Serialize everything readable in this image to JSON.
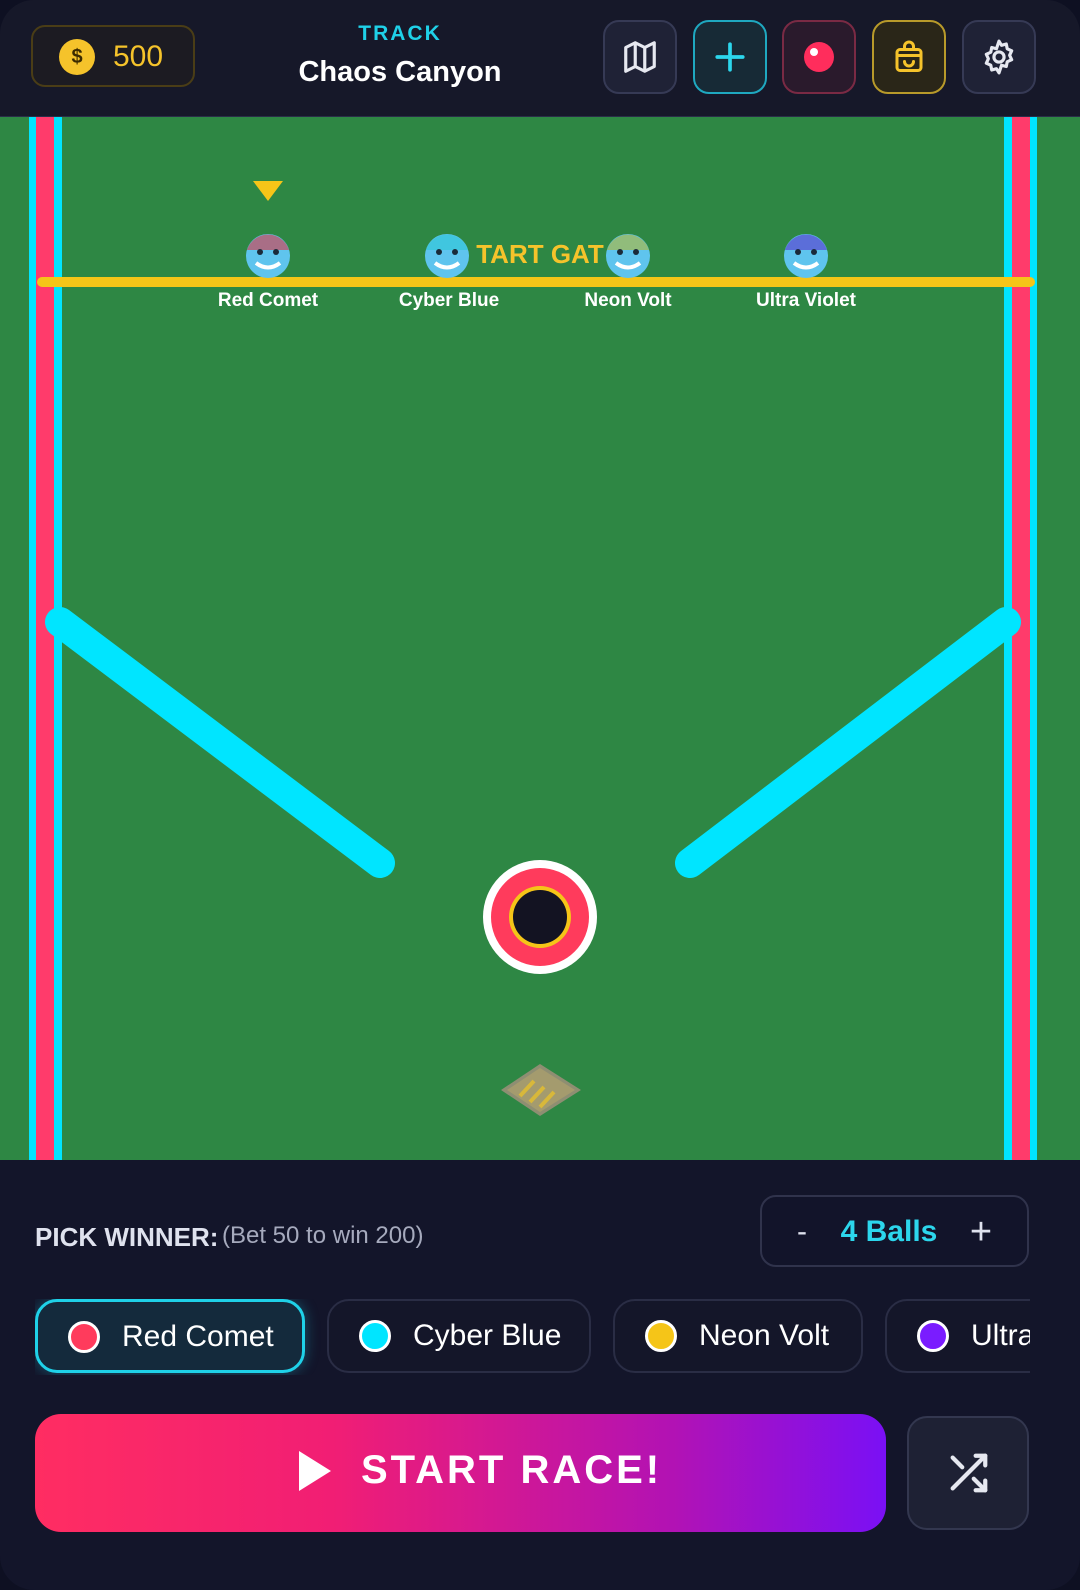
{
  "header": {
    "coins": "500",
    "coin_symbol": "$",
    "track_label": "TRACK",
    "track_name": "Chaos Canyon",
    "buttons": [
      {
        "name": "map-icon"
      },
      {
        "name": "plus-icon"
      },
      {
        "name": "record-icon"
      },
      {
        "name": "shopping-bag-icon"
      },
      {
        "name": "gear-icon"
      }
    ]
  },
  "field": {
    "gate_label": "TART GAT",
    "racers": [
      {
        "name": "Red Comet",
        "color": "#ff3b5c"
      },
      {
        "name": "Cyber Blue",
        "color": "#00e5ff"
      },
      {
        "name": "Neon Volt",
        "color": "#f5c518"
      },
      {
        "name": "Ultra Violet",
        "color": "#7a1cff"
      }
    ]
  },
  "panel": {
    "pick_title": "PICK WINNER:",
    "pick_sub": "(Bet 50 to win 200)",
    "balls_minus": "-",
    "balls_count": "4 Balls",
    "balls_plus": "+",
    "chips": [
      {
        "label": "Red Comet",
        "color": "#ff3b5c",
        "selected": true
      },
      {
        "label": "Cyber Blue",
        "color": "#00e5ff",
        "selected": false
      },
      {
        "label": "Neon Volt",
        "color": "#f5c518",
        "selected": false
      },
      {
        "label": "Ultra",
        "color": "#7a1cff",
        "selected": false
      }
    ],
    "start_label": "START RACE!"
  },
  "colors": {
    "accent_cyan": "#1fd1e8",
    "gold": "#f5c32b",
    "field_green": "#2e8744",
    "rail_pink": "#ff3b6b"
  }
}
